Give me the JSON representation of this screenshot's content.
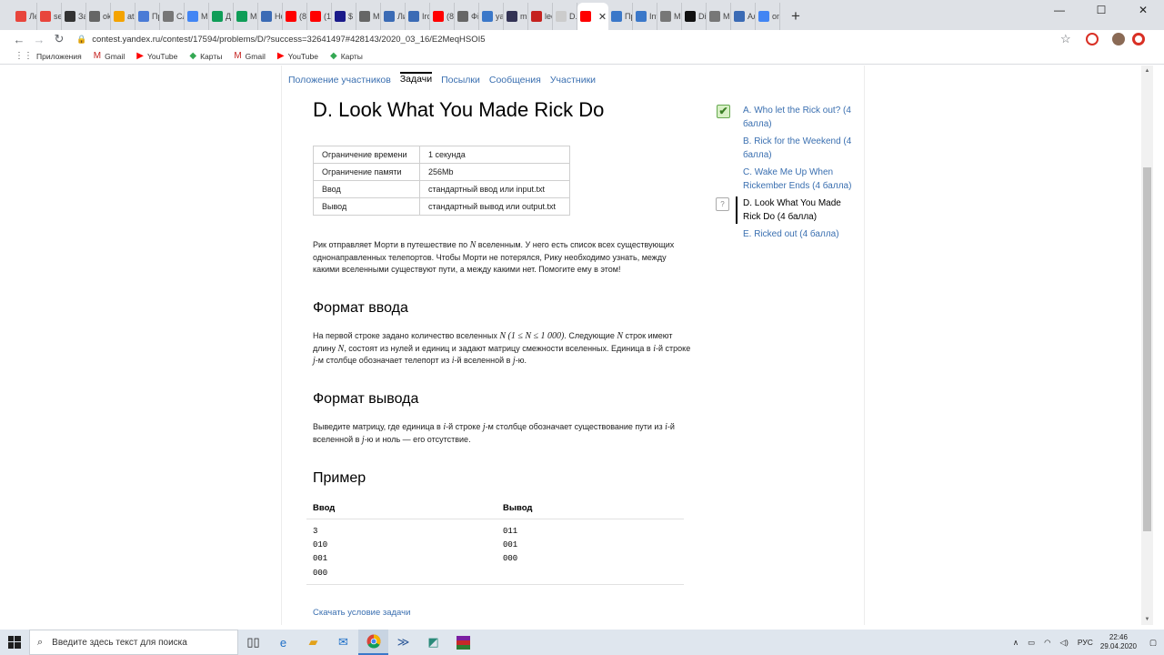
{
  "browser": {
    "tabs": [
      {
        "label": "Ле",
        "icon": "calendar-icon",
        "color": "#e8453c"
      },
      {
        "label": "se",
        "icon": "refresh-icon",
        "color": "#e8453c"
      },
      {
        "label": "За",
        "icon": "wix-icon",
        "color": "#333333"
      },
      {
        "label": "ok",
        "icon": "globe-icon",
        "color": "#666666"
      },
      {
        "label": "at",
        "icon": "grid-icon",
        "color": "#f4a300"
      },
      {
        "label": "Пр",
        "icon": "diamond-icon",
        "color": "#4a7bd6"
      },
      {
        "label": "Сл",
        "icon": "co-icon",
        "color": "#777777"
      },
      {
        "label": "М",
        "icon": "map-icon",
        "color": "#4285f4"
      },
      {
        "label": "Д",
        "icon": "drive-icon",
        "color": "#0f9d58"
      },
      {
        "label": "М",
        "icon": "drive-icon",
        "color": "#0f9d58"
      },
      {
        "label": "Нс",
        "icon": "monitor-icon",
        "color": "#3b6bb5"
      },
      {
        "label": "(8)",
        "icon": "youtube-icon",
        "color": "#ff0000"
      },
      {
        "label": "(1)",
        "icon": "youtube-icon",
        "color": "#ff0000"
      },
      {
        "label": "$ 1",
        "icon": "pi-icon",
        "color": "#1a1a8a"
      },
      {
        "label": "Ml",
        "icon": "globe-icon",
        "color": "#666666"
      },
      {
        "label": "Ли",
        "icon": "monitor-icon",
        "color": "#3b6bb5"
      },
      {
        "label": "Irc",
        "icon": "monitor-icon",
        "color": "#3b6bb5"
      },
      {
        "label": "(8)",
        "icon": "youtube-icon",
        "color": "#ff0000"
      },
      {
        "label": "Фі",
        "icon": "globe-icon",
        "color": "#666666"
      },
      {
        "label": "ya",
        "icon": "wave-icon",
        "color": "#3b78c9"
      },
      {
        "label": "m",
        "icon": "circle-icon",
        "color": "#333355"
      },
      {
        "label": "lec",
        "icon": "gmail-icon",
        "color": "#c5221f"
      },
      {
        "label": "D.",
        "icon": "yandex-icon",
        "color": "#cccccc"
      },
      {
        "label": "",
        "icon": "yandex-icon",
        "color": "#ff0000",
        "active": true
      },
      {
        "label": "Пр",
        "icon": "wave-icon",
        "color": "#3b78c9"
      },
      {
        "label": "Inf",
        "icon": "wave-icon",
        "color": "#3b78c9"
      },
      {
        "label": "Mi",
        "icon": "horse-icon",
        "color": "#777777"
      },
      {
        "label": "Di",
        "icon": "github-icon",
        "color": "#111111"
      },
      {
        "label": "M",
        "icon": "horse-icon",
        "color": "#777777"
      },
      {
        "label": "Ал",
        "icon": "monitor-icon",
        "color": "#3b6bb5"
      },
      {
        "label": "on",
        "icon": "google-icon",
        "color": "#4285f4"
      }
    ],
    "url": "contest.yandex.ru/contest/17594/problems/D/?success=32641497#428143/2020_03_16/E2MeqHSOI5",
    "bookmarks": [
      {
        "label": "Приложения",
        "icon": "apps-icon",
        "color": "#555555"
      },
      {
        "label": "Gmail",
        "icon": "gmail-icon",
        "color": "#c5221f"
      },
      {
        "label": "YouTube",
        "icon": "youtube-icon",
        "color": "#ff0000"
      },
      {
        "label": "Карты",
        "icon": "map-icon",
        "color": "#34a853"
      },
      {
        "label": "Gmail",
        "icon": "gmail-icon",
        "color": "#c5221f"
      },
      {
        "label": "YouTube",
        "icon": "youtube-icon",
        "color": "#ff0000"
      },
      {
        "label": "Карты",
        "icon": "map-icon",
        "color": "#34a853"
      }
    ]
  },
  "nav": {
    "standings": "Положение участников",
    "problems": "Задачи",
    "submissions": "Посылки",
    "messages": "Сообщения",
    "participants": "Участники"
  },
  "problem": {
    "title": "D. Look What You Made Rick Do",
    "limits": [
      {
        "key": "Ограничение времени",
        "value": "1 секунда"
      },
      {
        "key": "Ограничение памяти",
        "value": "256Mb"
      },
      {
        "key": "Ввод",
        "value": "стандартный ввод или input.txt"
      },
      {
        "key": "Вывод",
        "value": "стандартный вывод или output.txt"
      }
    ],
    "statement": {
      "p1a": "Рик отправляет Морти в путешествие по ",
      "N": "N",
      "p1b": " вселенным. У него есть список всех существующих однонаправленных телепортов. Чтобы Морти не потерялся, Рику необходимо узнать, между какими вселенными существуют пути, а между какими нет. Помогите ему в этом!"
    },
    "input_heading": "Формат ввода",
    "input_text": {
      "a": "На первой строке задано количество вселенных ",
      "N": "N",
      "range": "(1 ≤ N ≤ 1 000)",
      "b": ". Следующие ",
      "c": " строк имеют длину ",
      "d": ", состоят из нулей и единиц и задают матрицу смежности вселенных. Единица в ",
      "i": "i",
      "e": "-й строке ",
      "j": "j",
      "f": "-м столбце обозначает телепорт из ",
      "g": "-й вселенной в ",
      "h": "-ю."
    },
    "output_heading": "Формат вывода",
    "output_text": {
      "a": "Выведите матрицу, где единица в ",
      "i": "i",
      "b": "-й строке ",
      "j": "j",
      "c": "-м столбце обозначает существование пути из ",
      "d": "-й вселенной в ",
      "e": "-ю и ноль — его отсутствие."
    },
    "example_heading": "Пример",
    "example": {
      "input_label": "Ввод",
      "output_label": "Вывод",
      "input": "3\n010\n001\n000",
      "output": "011\n001\n000"
    },
    "download": "Скачать условие задачи"
  },
  "problem_list": [
    {
      "label": "A. Who let the Rick out? (4 балла)",
      "status": "✔",
      "state": "accepted"
    },
    {
      "label": "B. Rick for the Weekend (4 балла)",
      "status": "",
      "state": "none"
    },
    {
      "label": "C. Wake Me Up When Rickember Ends (4 балла)",
      "status": "",
      "state": "none"
    },
    {
      "label": "D. Look What You Made Rick Do (4 балла)",
      "status": "?",
      "state": "current"
    },
    {
      "label": "E. Ricked out (4 балла)",
      "status": "",
      "state": "none"
    }
  ],
  "taskbar": {
    "search_placeholder": "Введите здесь текст для поиска",
    "lang": "РУС",
    "time": "22:46",
    "date": "29.04.2020"
  }
}
